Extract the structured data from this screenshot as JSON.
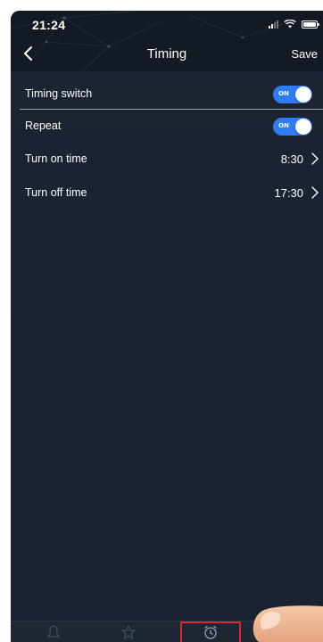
{
  "status_bar": {
    "time": "21:24"
  },
  "nav": {
    "back_icon": "chevron-left-icon",
    "title": "Timing",
    "save_label": "Save"
  },
  "settings": {
    "timing_switch": {
      "label": "Timing switch",
      "toggle_text": "ON",
      "enabled": true
    },
    "repeat": {
      "label": "Repeat",
      "toggle_text": "ON",
      "enabled": true
    },
    "turn_on_time": {
      "label": "Turn on time",
      "value": "8:30"
    },
    "turn_off_time": {
      "label": "Turn off time",
      "value": "17:30"
    }
  },
  "tab_bar": {
    "tabs": [
      {
        "icon": "bell-icon",
        "selected": false
      },
      {
        "icon": "star-icon",
        "selected": false
      },
      {
        "icon": "alarm-clock-icon",
        "selected": true
      }
    ]
  },
  "colors": {
    "background": "#1b2332",
    "header": "#141a24",
    "toggle_on": "#2f7df6",
    "highlight_box": "#e0262b",
    "text": "#ffffff"
  }
}
